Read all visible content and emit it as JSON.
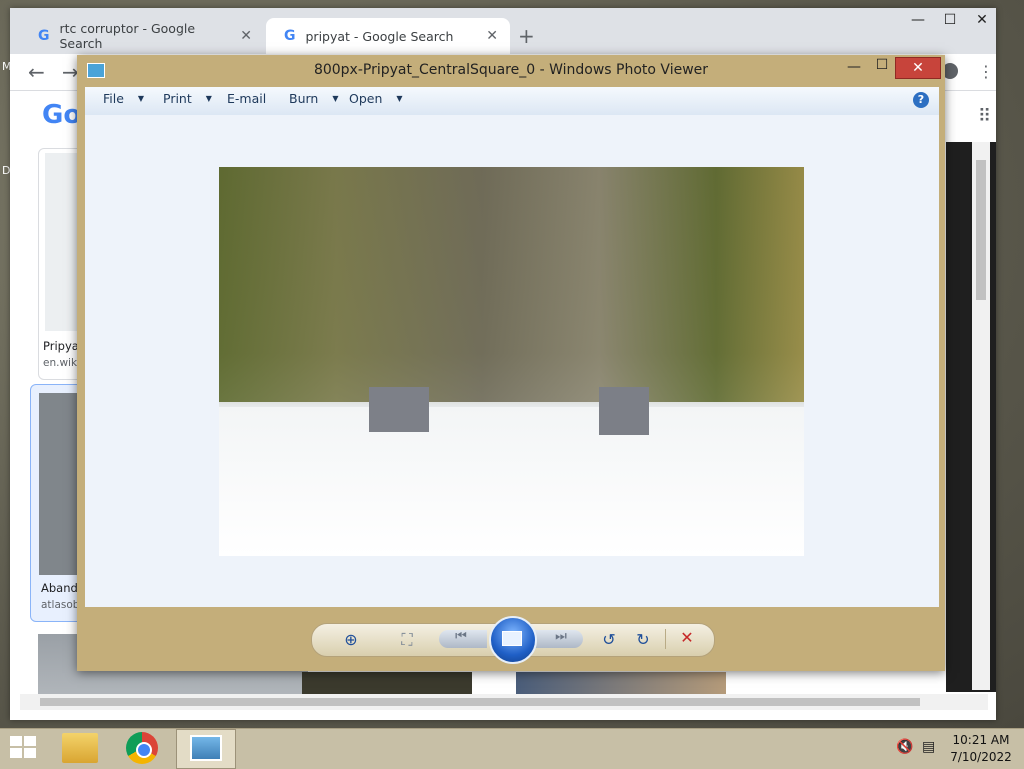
{
  "chrome": {
    "tabs": [
      {
        "label": "rtc corruptor - Google Search"
      },
      {
        "label": "pripyat - Google Search"
      }
    ],
    "new_tab_icon": "+",
    "logo_text": "Go",
    "results": [
      {
        "title": "Pripyat",
        "source": "en.wiki"
      },
      {
        "title": "Aband",
        "source": "atlasob"
      }
    ]
  },
  "photo_viewer": {
    "title": "800px-Pripyat_CentralSquare_0 - Windows Photo Viewer",
    "menu": [
      "File",
      "Print",
      "E-mail",
      "Burn",
      "Open"
    ],
    "help_icon": "?",
    "controls": {
      "zoom": "zoom-icon",
      "actual_size": "actual-size-icon",
      "previous": "previous-icon",
      "slideshow": "slideshow-icon",
      "next": "next-icon",
      "rotate_ccw": "rotate-counterclockwise-icon",
      "rotate_cw": "rotate-clockwise-icon",
      "delete": "delete-icon"
    }
  },
  "taskbar": {
    "clock_time": "10:21 AM",
    "clock_date": "7/10/2022"
  },
  "desktop_edge_text": [
    "M",
    "D"
  ]
}
